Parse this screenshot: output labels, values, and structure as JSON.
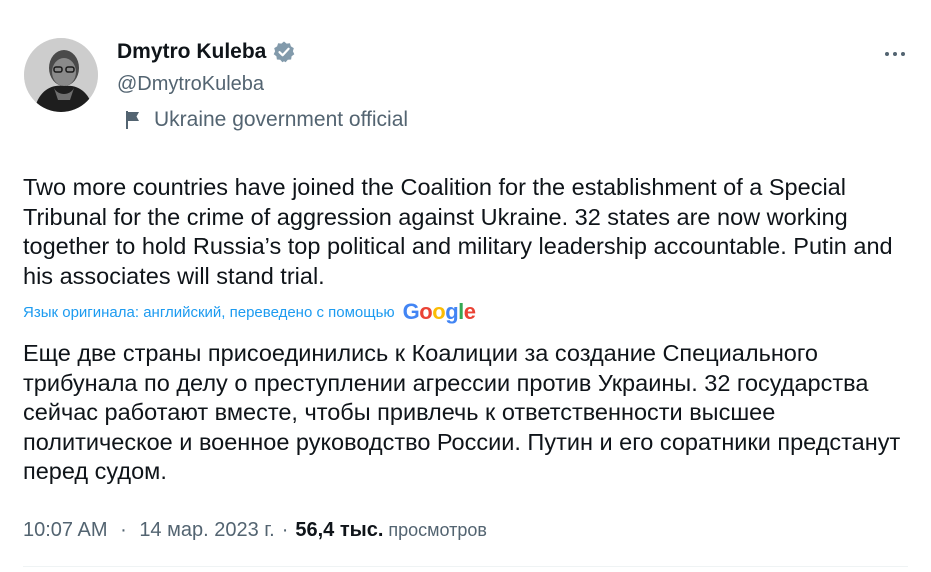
{
  "author": {
    "display_name": "Dmytro Kuleba",
    "handle": "@DmytroKuleba",
    "verified": true,
    "affiliation": "Ukraine government official"
  },
  "tweet": {
    "text_original": "Two more countries have joined the Coalition for the establishment of a Special Tribunal for the crime of aggression against Ukraine. 32 states are now working together to hold Russia’s top political and military leadership accountable. Putin and his associates will stand trial.",
    "translation_note": "Язык оригинала: английский, переведено с помощью",
    "translation_provider": "Google",
    "text_translated": "Еще две страны присоединились к Коалиции за создание Специального трибунала по делу о преступлении агрессии против Украины. 32 государства сейчас работают вместе, чтобы привлечь к ответственности высшее политическое и военное руководство России. Путин и его соратники предстанут перед судом."
  },
  "meta": {
    "time": "10:07 AM",
    "separator": "·",
    "date": "14 мар. 2023 г.",
    "views_count": "56,4 тыс.",
    "views_label": "просмотров"
  },
  "icons": {
    "verified": "verified-badge-icon",
    "affiliation": "flag-icon",
    "more": "more-options-icon"
  },
  "colors": {
    "text_primary": "#0f1419",
    "text_secondary": "#536471",
    "link": "#1d9bf0",
    "verified": "#829aab"
  }
}
